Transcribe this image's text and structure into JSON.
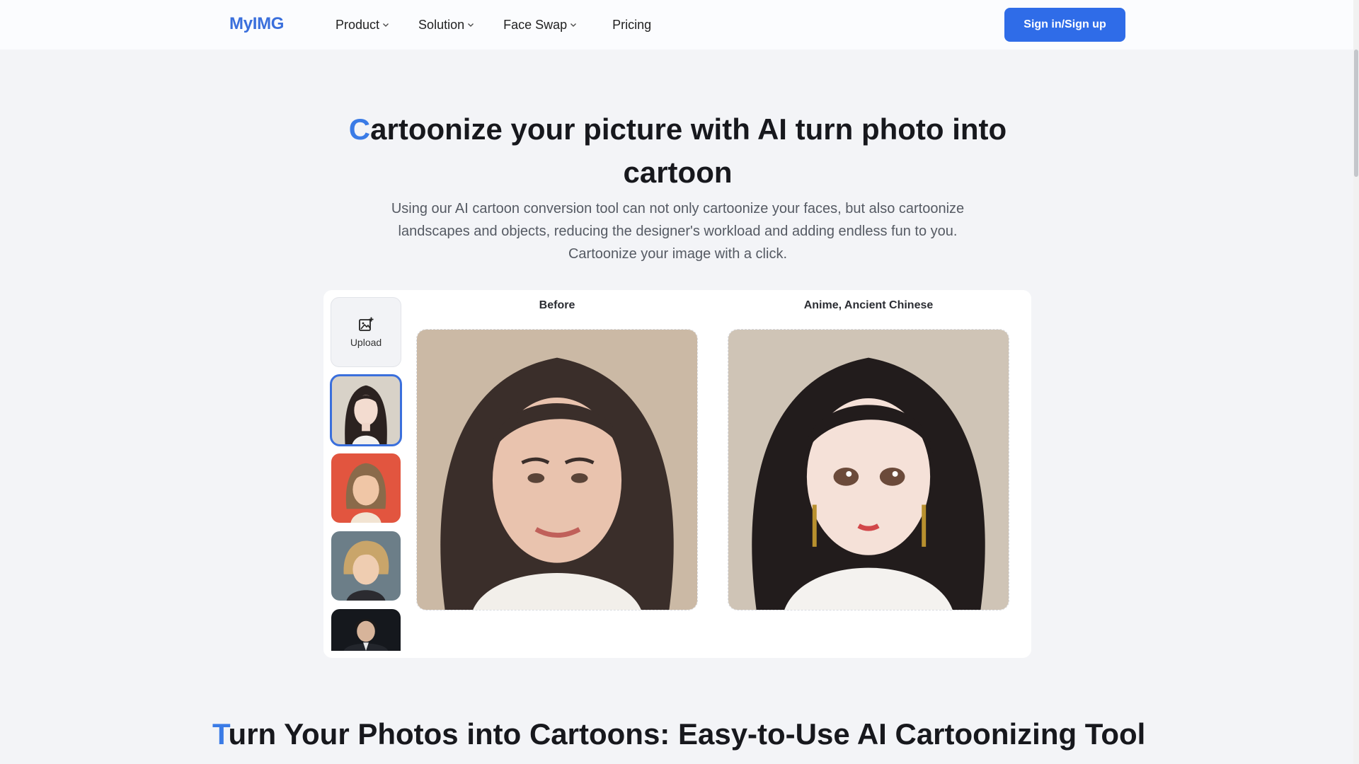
{
  "header": {
    "logo": "MyIMG",
    "nav": [
      {
        "label": "Product",
        "has_dropdown": true
      },
      {
        "label": "Solution",
        "has_dropdown": true
      },
      {
        "label": "Face Swap",
        "has_dropdown": true
      },
      {
        "label": "Pricing",
        "has_dropdown": false
      }
    ],
    "signin_label": "Sign in/Sign up"
  },
  "hero": {
    "title_first_letter": "C",
    "title_rest": "artoonize your picture with AI turn photo into cartoon",
    "description": "Using our AI cartoon conversion tool can not only cartoonize your faces, but also cartoonize landscapes and objects, reducing the designer's workload and adding endless fun to you. Cartoonize your image with a click."
  },
  "tool": {
    "upload_label": "Upload",
    "upload_icon": "image-plus-icon",
    "thumbnails": [
      {
        "name": "anime-ancient-chinese-girl",
        "selected": true
      },
      {
        "name": "cartoon-girl-red-background",
        "selected": false
      },
      {
        "name": "blond-anime-boy",
        "selected": false
      },
      {
        "name": "anime-man-in-suit",
        "selected": false
      }
    ],
    "before_label": "Before",
    "after_label": "Anime, Ancient Chinese"
  },
  "section": {
    "title_first_letter": "T",
    "title_rest": "urn Your Photos into Cartoons: Easy-to-Use AI Cartoonizing Tool"
  },
  "colors": {
    "accent": "#3a7be6",
    "button": "#2f6ce8",
    "background": "#f3f4f7"
  }
}
